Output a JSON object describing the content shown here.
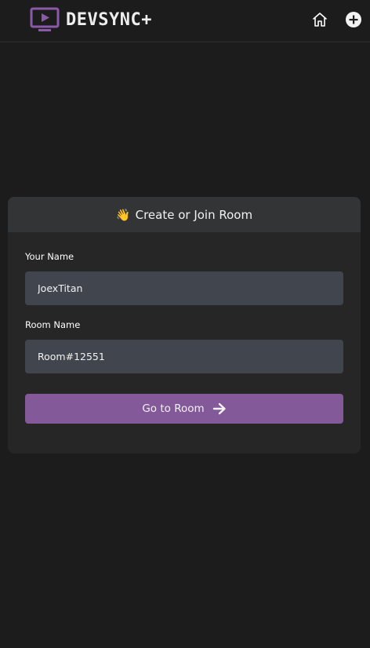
{
  "header": {
    "brand_name": "DEVSYNC+",
    "brand_icon": "tv-play-icon",
    "brand_color": "#8a5aa8",
    "nav": [
      {
        "icon": "home-icon"
      },
      {
        "icon": "plus-circle-icon"
      }
    ]
  },
  "card": {
    "emoji": "👋",
    "title": "Create or Join Room",
    "name_label": "Your Name",
    "name_value": "JoexTitan",
    "room_label": "Room Name",
    "room_value": "Room#12551",
    "button_label": "Go to Room",
    "button_icon": "arrow-right-icon",
    "button_color": "#83599a"
  }
}
